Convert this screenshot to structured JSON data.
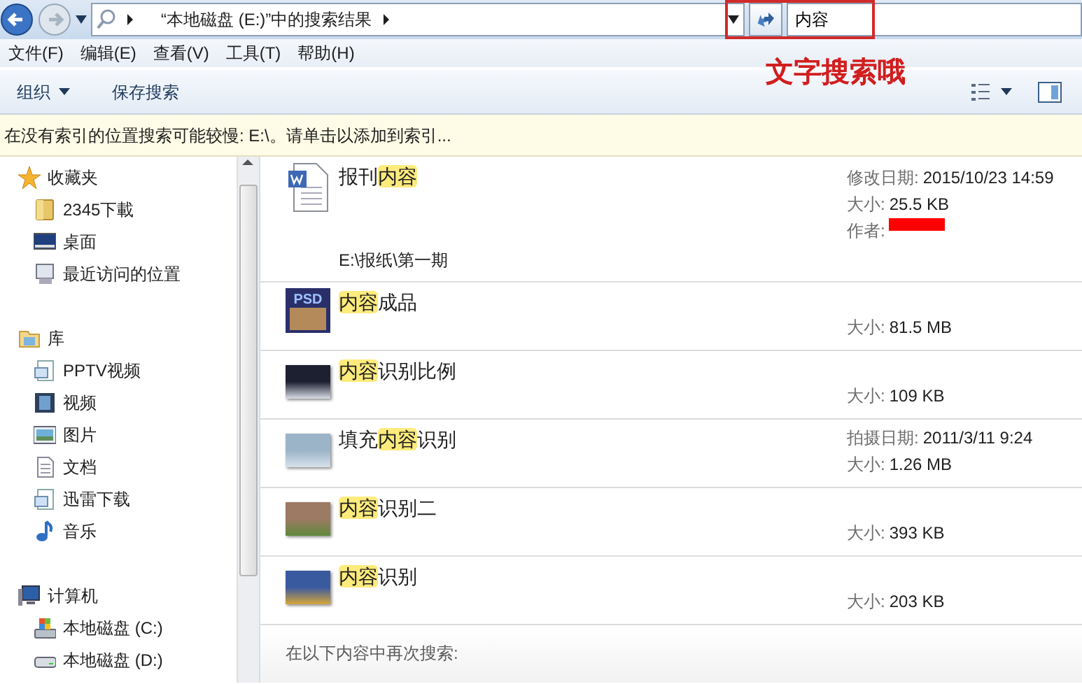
{
  "address_bar": {
    "breadcrumb": "“本地磁盘 (E:)”中的搜索结果",
    "search": {
      "value": "内容"
    }
  },
  "menu": [
    "文件(F)",
    "编辑(E)",
    "查看(V)",
    "工具(T)",
    "帮助(H)"
  ],
  "toolbar": {
    "organize": "组织",
    "save_search": "保存搜索"
  },
  "info_bar": "在没有索引的位置搜索可能较慢: E:\\。请单击以添加到索引...",
  "sidebar": [
    {
      "label": "收藏夹",
      "kind": "star",
      "items": [
        {
          "label": "2345下載",
          "kind": "folder"
        },
        {
          "label": "桌面",
          "kind": "desktop"
        },
        {
          "label": "最近访问的位置",
          "kind": "recent"
        }
      ]
    },
    {
      "label": "库",
      "kind": "library",
      "items": [
        {
          "label": "PPTV视频",
          "kind": "libdoc"
        },
        {
          "label": "视频",
          "kind": "video"
        },
        {
          "label": "图片",
          "kind": "picture"
        },
        {
          "label": "文档",
          "kind": "document"
        },
        {
          "label": "迅雷下载",
          "kind": "libdoc"
        },
        {
          "label": "音乐",
          "kind": "music"
        }
      ]
    },
    {
      "label": "计算机",
      "kind": "computer",
      "items": [
        {
          "label": "本地磁盘 (C:)",
          "kind": "systemdisk"
        },
        {
          "label": "本地磁盘 (D:)",
          "kind": "disk"
        }
      ]
    }
  ],
  "results": [
    {
      "kind": "word",
      "name": [
        {
          "text": "报刊",
          "hit": false
        },
        {
          "text": "内容",
          "hit": true
        }
      ],
      "path": "E:\\报纸\\第一期",
      "details": [
        {
          "label": "修改日期:",
          "value": "2015/10/23 14:59"
        },
        {
          "label": "大小:",
          "value": "25.5 KB"
        },
        {
          "label": "作者:",
          "redacted": true
        }
      ]
    },
    {
      "kind": "psd",
      "thumbnail_text": "PSD",
      "name": [
        {
          "text": "内容",
          "hit": true
        },
        {
          "text": "成品",
          "hit": false
        }
      ],
      "details": [
        {
          "label": "大小:",
          "value": "81.5 MB"
        }
      ]
    },
    {
      "kind": "photo",
      "name": [
        {
          "text": "内容",
          "hit": true
        },
        {
          "text": "识别比例",
          "hit": false
        }
      ],
      "details": [
        {
          "label": "大小:",
          "value": "109 KB"
        }
      ]
    },
    {
      "kind": "photo",
      "name": [
        {
          "text": "填充",
          "hit": false
        },
        {
          "text": "内容",
          "hit": true
        },
        {
          "text": "识别",
          "hit": false
        }
      ],
      "details": [
        {
          "label": "拍摄日期:",
          "value": "2011/3/11 9:24"
        },
        {
          "label": "大小:",
          "value": "1.26 MB"
        }
      ]
    },
    {
      "kind": "photo",
      "name": [
        {
          "text": "内容",
          "hit": true
        },
        {
          "text": "识别二",
          "hit": false
        }
      ],
      "details": [
        {
          "label": "大小:",
          "value": "393 KB"
        }
      ]
    },
    {
      "kind": "photo",
      "name": [
        {
          "text": "内容",
          "hit": true
        },
        {
          "text": "识别",
          "hit": false
        }
      ],
      "details": [
        {
          "label": "大小:",
          "value": "203 KB"
        }
      ]
    }
  ],
  "search_again": "在以下内容中再次搜索:",
  "annotation": {
    "text": "文字搜索哦"
  }
}
